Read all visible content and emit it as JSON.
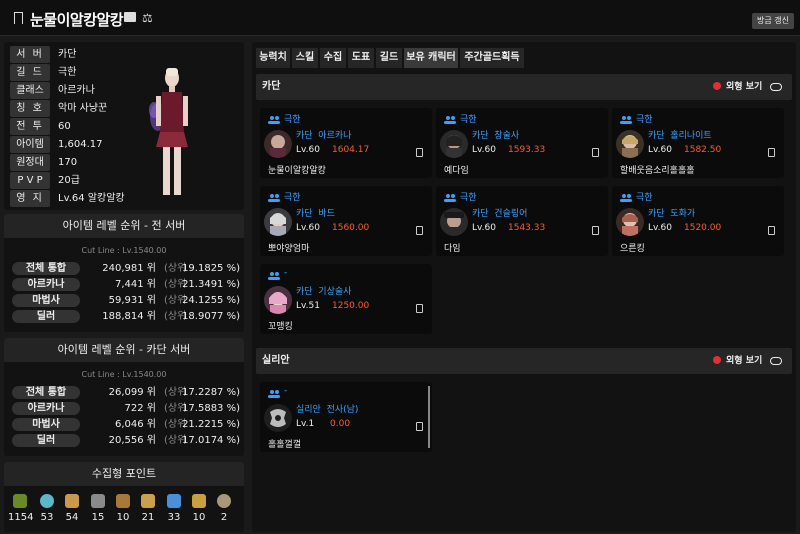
{
  "header": {
    "title": "눈물이알캉알캉",
    "refresh_label": "방금 갱신"
  },
  "profile": {
    "rows": [
      {
        "label": "서 버",
        "value": "카단"
      },
      {
        "label": "길 드",
        "value": "극한"
      },
      {
        "label": "클래스",
        "value": "아르카나"
      },
      {
        "label": "칭 호",
        "value": "악마 사냥꾼"
      },
      {
        "label": "전 투",
        "value": "60"
      },
      {
        "label": "아이템",
        "value": "1,604.17"
      },
      {
        "label": "원정대",
        "value": "170"
      },
      {
        "label": "P V P",
        "value": "20급"
      },
      {
        "label": "영 지",
        "value": "Lv.64 알캉알캉"
      }
    ]
  },
  "rank_all": {
    "title": "아이템 레벨 순위 - 전 서버",
    "cutline": "Cut Line : Lv.1540.00",
    "rows": [
      {
        "label": "전체 통합",
        "value": "240,981 위",
        "pct_label": "(상위",
        "pct": "19.1825 %)"
      },
      {
        "label": "아르카나",
        "value": "7,441 위",
        "pct_label": "(상위",
        "pct": "21.3491 %)"
      },
      {
        "label": "마법사",
        "value": "59,931 위",
        "pct_label": "(상위",
        "pct": "24.1255 %)"
      },
      {
        "label": "딜러",
        "value": "188,814 위",
        "pct_label": "(상위",
        "pct": "18.9077 %)"
      }
    ]
  },
  "rank_server": {
    "title": "아이템 레벨 순위 - 카단 서버",
    "cutline": "Cut Line : Lv.1540.00",
    "rows": [
      {
        "label": "전체 통합",
        "value": "26,099 위",
        "pct_label": "(상위",
        "pct": "17.2287 %)"
      },
      {
        "label": "아르카나",
        "value": "722 위",
        "pct_label": "(상위",
        "pct": "17.5883 %)"
      },
      {
        "label": "마법사",
        "value": "6,046 위",
        "pct_label": "(상위",
        "pct": "21.2215 %)"
      },
      {
        "label": "딜러",
        "value": "20,556 위",
        "pct_label": "(상위",
        "pct": "17.0174 %)"
      }
    ]
  },
  "collection": {
    "title": "수집형 포인트",
    "items": [
      {
        "icon": "mokoko-seed-icon",
        "color": "#6a8a2a",
        "value": "1154"
      },
      {
        "icon": "island-heart-icon",
        "color": "#5ab8c8",
        "value": "53"
      },
      {
        "icon": "great-artwork-icon",
        "color": "#c89a4a",
        "value": "54"
      },
      {
        "icon": "giant-heart-icon",
        "color": "#8a8a8a",
        "value": "15"
      },
      {
        "icon": "ignea-token-icon",
        "color": "#a8783a",
        "value": "10"
      },
      {
        "icon": "voyage-orb-icon",
        "color": "#c8a050",
        "value": "21"
      },
      {
        "icon": "sea-bounty-icon",
        "color": "#4a90d8",
        "value": "33"
      },
      {
        "icon": "world-tree-leaf-icon",
        "color": "#c8a040",
        "value": "10"
      },
      {
        "icon": "orpheus-star-icon",
        "color": "#a89878",
        "value": "2"
      }
    ]
  },
  "tabs": [
    "능력치",
    "스킬",
    "수집",
    "도표",
    "길드",
    "보유 캐릭터",
    "주간골드획득"
  ],
  "active_tab": "보유 캐릭터",
  "servers": [
    {
      "name": "카단",
      "view_label": "외형 보기",
      "characters": [
        {
          "guild": "극한",
          "server": "카단",
          "class": "아르카나",
          "level": "Lv.60",
          "item_level": "1604.17",
          "name": "눈물이알캉알캉"
        },
        {
          "guild": "극한",
          "server": "카단",
          "class": "창술사",
          "level": "Lv.60",
          "item_level": "1593.33",
          "name": "예다임"
        },
        {
          "guild": "극한",
          "server": "카단",
          "class": "홀리나이트",
          "level": "Lv.60",
          "item_level": "1582.50",
          "name": "할배웃음소리홀홀홀"
        },
        {
          "guild": "극한",
          "server": "카단",
          "class": "바드",
          "level": "Lv.60",
          "item_level": "1560.00",
          "name": "뽀야양엄마"
        },
        {
          "guild": "극한",
          "server": "카단",
          "class": "건슬링어",
          "level": "Lv.60",
          "item_level": "1543.33",
          "name": "다임"
        },
        {
          "guild": "극한",
          "server": "카단",
          "class": "도화가",
          "level": "Lv.60",
          "item_level": "1520.00",
          "name": "으른킹"
        },
        {
          "guild": "-",
          "server": "카단",
          "class": "기상술사",
          "level": "Lv.51",
          "item_level": "1250.00",
          "name": "꼬맹킹"
        }
      ]
    },
    {
      "name": "실리안",
      "view_label": "외형 보기",
      "characters": [
        {
          "guild": "-",
          "server": "실리안",
          "class": "전사(남)",
          "level": "Lv.1",
          "item_level": "0.00",
          "name": "홀홀껄껄"
        }
      ]
    }
  ]
}
